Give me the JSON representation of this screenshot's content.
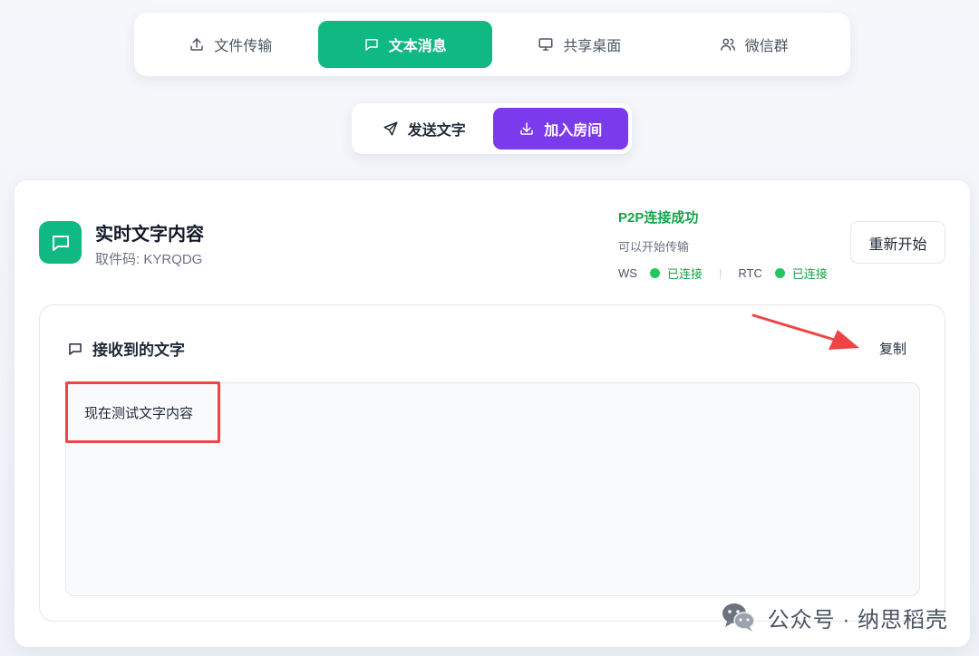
{
  "top_tabs": [
    {
      "label": "文件传输",
      "icon": "upload-icon",
      "active": false
    },
    {
      "label": "文本消息",
      "icon": "message-icon",
      "active": true
    },
    {
      "label": "共享桌面",
      "icon": "monitor-icon",
      "active": false
    },
    {
      "label": "微信群",
      "icon": "users-icon",
      "active": false
    }
  ],
  "mode": {
    "send_label": "发送文字",
    "join_label": "加入房间"
  },
  "card": {
    "title": "实时文字内容",
    "code": "取件码: KYRQDG",
    "restart_label": "重新开始"
  },
  "status": {
    "title": "P2P连接成功",
    "subtitle": "可以开始传输",
    "ws_label": "WS",
    "ws_state": "已连接",
    "separator": "|",
    "rtc_label": "RTC",
    "rtc_state": "已连接"
  },
  "received": {
    "heading": "接收到的文字",
    "copy_label": "复制",
    "content": "现在测试文字内容"
  },
  "watermark": {
    "text": "公众号 · 纳思稻壳"
  },
  "colors": {
    "green": "#10b981",
    "purple": "#7c3aed",
    "status_green": "#16a34a",
    "annotation_red": "#ef4444"
  }
}
